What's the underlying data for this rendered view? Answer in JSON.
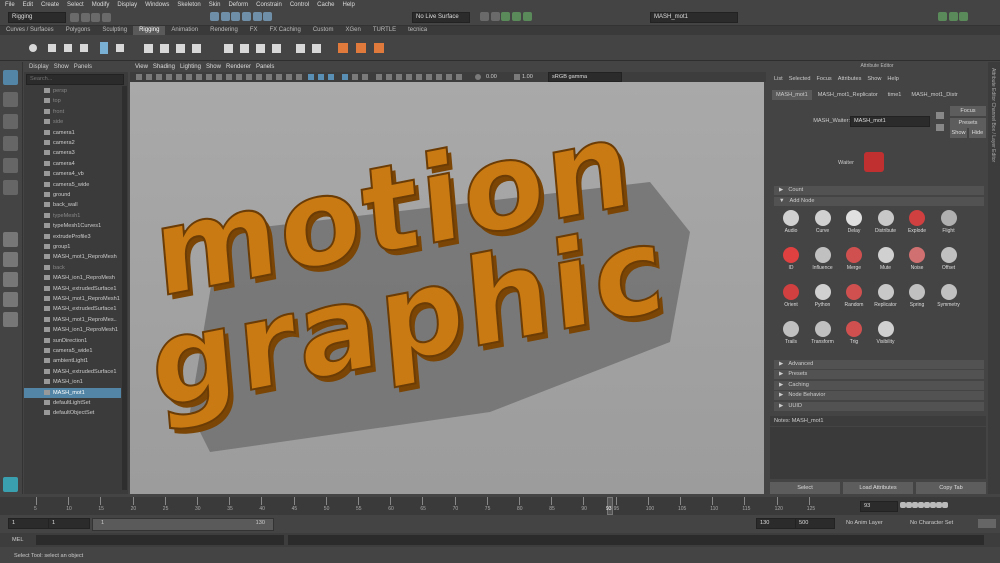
{
  "menubar": [
    "File",
    "Edit",
    "Create",
    "Select",
    "Modify",
    "Display",
    "Windows",
    "Skeleton",
    "Skin",
    "Deform",
    "Constrain",
    "Control",
    "Cache",
    "Help"
  ],
  "status": {
    "menuset": "Rigging",
    "live_surface": "No Live Surface",
    "object_name": "MASH_mot1"
  },
  "shelf_tabs": [
    "Curves / Surfaces",
    "Polygons",
    "Sculpting",
    "Rigging",
    "Animation",
    "Rendering",
    "FX",
    "FX Caching",
    "Custom",
    "XGen",
    "TURTLE",
    "tecnica"
  ],
  "active_shelf": "Rigging",
  "outliner": {
    "menu": [
      "Display",
      "Show",
      "Panels"
    ],
    "search_placeholder": "Search...",
    "items": [
      {
        "label": "persp",
        "dim": true
      },
      {
        "label": "top",
        "dim": true
      },
      {
        "label": "front",
        "dim": true
      },
      {
        "label": "side",
        "dim": true
      },
      {
        "label": "camera1",
        "dim": false
      },
      {
        "label": "camera2",
        "dim": false
      },
      {
        "label": "camera3",
        "dim": false
      },
      {
        "label": "camera4",
        "dim": false
      },
      {
        "label": "camera4_vb",
        "dim": false
      },
      {
        "label": "camera5_wide",
        "dim": false
      },
      {
        "label": "ground",
        "dim": false
      },
      {
        "label": "back_wall",
        "dim": false
      },
      {
        "label": "typeMesh1",
        "dim": true
      },
      {
        "label": "typeMesh1Curves1",
        "dim": false
      },
      {
        "label": "extrudeProfile3",
        "dim": false
      },
      {
        "label": "group1",
        "dim": false
      },
      {
        "label": "MASH_mot1_ReproMesh",
        "dim": false
      },
      {
        "label": "back",
        "dim": true
      },
      {
        "label": "MASH_ion1_ReproMesh",
        "dim": false
      },
      {
        "label": "MASH_extrudedSurface1",
        "dim": false
      },
      {
        "label": "MASH_mot1_ReproMesh1",
        "dim": false
      },
      {
        "label": "MASH_extrudedSurface1",
        "dim": false
      },
      {
        "label": "MASH_mot1_ReproMes..",
        "dim": false
      },
      {
        "label": "MASH_ion1_ReproMesh1",
        "dim": false
      },
      {
        "label": "sunDirection1",
        "dim": false
      },
      {
        "label": "camera5_wide1",
        "dim": false
      },
      {
        "label": "ambientLight1",
        "dim": false
      },
      {
        "label": "MASH_extrudedSurface1",
        "dim": false
      },
      {
        "label": "MASH_ion1",
        "dim": false
      },
      {
        "label": "MASH_mot1",
        "dim": false,
        "selected": true
      },
      {
        "label": "defaultLightSet",
        "dim": false
      },
      {
        "label": "defaultObjectSet",
        "dim": false
      }
    ]
  },
  "viewport": {
    "menu": [
      "View",
      "Shading",
      "Lighting",
      "Show",
      "Renderer",
      "Panels"
    ],
    "exposure": "0.00",
    "gamma": "1.00",
    "colorspace": "sRGB gamma",
    "scene_text_line1": "motion",
    "scene_text_line2": "graphic"
  },
  "attribute_editor": {
    "title": "Attribute Editor",
    "menu": [
      "List",
      "Selected",
      "Focus",
      "Attributes",
      "Show",
      "Help"
    ],
    "tabs": [
      "MASH_mot1",
      "MASH_mot1_Replicator",
      "time1",
      "MASH_mot1_Distr"
    ],
    "waiter_label": "MASH_Waiter:",
    "waiter_value": "MASH_mot1",
    "focus_btn": "Focus",
    "presets_btn": "Presets",
    "show_btn": "Show",
    "hide_btn": "Hide",
    "waiter_icon_label": "Waiter",
    "count_section": "Count",
    "add_node_section": "Add Node",
    "nodes": [
      "Audio",
      "Curve",
      "Delay",
      "Distribute",
      "Explode",
      "Flight",
      "ID",
      "Influence",
      "Merge",
      "Mute",
      "Noise",
      "Offset",
      "Orient",
      "Python",
      "Random",
      "Replicator",
      "Spring",
      "Symmetry",
      "Trails",
      "Transform",
      "Trig",
      "Visibility"
    ],
    "sections": [
      "Advanced",
      "Presets",
      "Caching",
      "Node Behavior",
      "UUID"
    ],
    "notes_label": "Notes: MASH_mot1",
    "bottom_buttons": [
      "Select",
      "Load Attributes",
      "Copy Tab"
    ],
    "side_tabs": "Attribute Editor   Channel Box / Layer Editor"
  },
  "timeline": {
    "ticks": [
      "5",
      "10",
      "15",
      "20",
      "25",
      "30",
      "35",
      "40",
      "45",
      "50",
      "55",
      "60",
      "65",
      "70",
      "75",
      "80",
      "85",
      "90",
      "95",
      "100",
      "105",
      "110",
      "115",
      "120",
      "125"
    ],
    "current_frame": "93",
    "current_frame_field": "93"
  },
  "range": {
    "start": "1",
    "start2": "1",
    "slider_start": "1",
    "slider_end": "130",
    "end": "130",
    "end2": "500",
    "anim_layer": "No Anim Layer",
    "char_set": "No Character Set"
  },
  "mel_label": "MEL",
  "help_line": "Select Tool: select an object",
  "colors": {
    "accent": "#5285a6",
    "viewport_bg": "#a3a3a3",
    "text_orange": "#c97a12"
  }
}
